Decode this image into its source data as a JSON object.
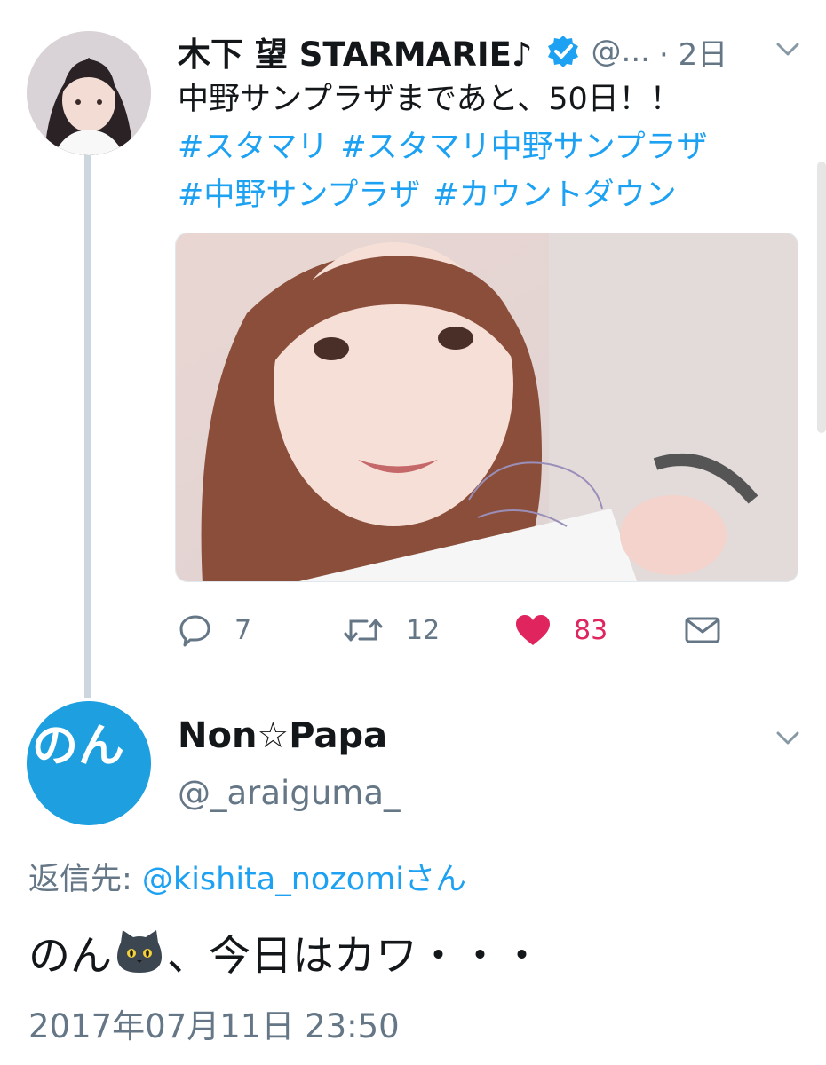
{
  "tweet": {
    "author_name": "木下 望 STARMARIE♪",
    "handle": "@...",
    "time": "· 2日",
    "text": "中野サンプラザまであと、50日！！",
    "hashtags": [
      "#スタマリ",
      "#スタマリ中野サンプラザ",
      "#中野サンプラザ",
      "#カウントダウン"
    ],
    "reply_count": "7",
    "retweet_count": "12",
    "like_count": "83"
  },
  "reply": {
    "author_name": "Non☆Papa",
    "handle": "@_araiguma_",
    "avatar_text": "のん",
    "reply_to_prefix": "返信先: ",
    "reply_to_handle": "@kishita_nozomi",
    "reply_to_suffix": "さん",
    "text_before": "のん",
    "text_after": "、今日はカワ・・・",
    "timestamp": "2017年07月11日 23:50"
  },
  "colors": {
    "accent": "#1da1f2",
    "like": "#e0245e",
    "secondary_text": "#657786",
    "thread_line": "#ccd6dd"
  },
  "icons": {
    "verified": "verified-badge-icon",
    "caret": "chevron-down-icon",
    "reply": "reply-bubble-icon",
    "retweet": "retweet-icon",
    "like": "heart-icon",
    "dm": "envelope-icon",
    "emoji": "black-cat-face-emoji"
  }
}
